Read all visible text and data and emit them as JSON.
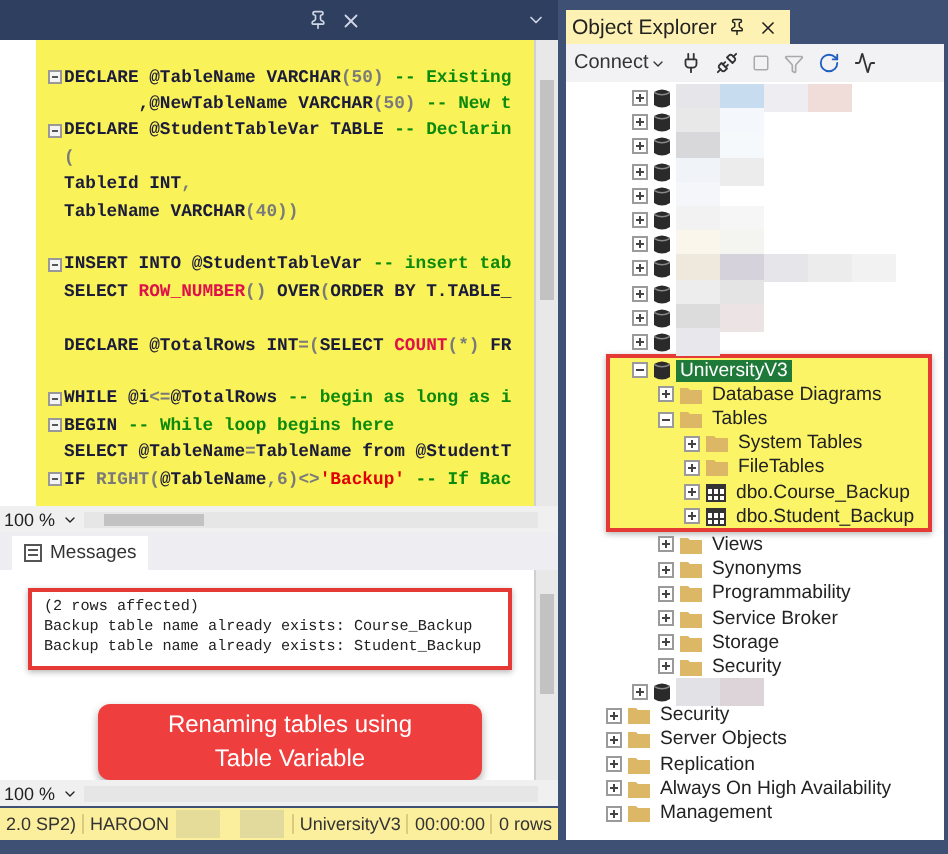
{
  "editor": {
    "lines": [
      {
        "fold": true,
        "tokens": [
          {
            "kind": "kw",
            "text": "DECLARE @TableName VARCHAR"
          },
          {
            "kind": "punct",
            "text": "(50)"
          },
          {
            "kind": "comment",
            "text": " -- Existing"
          }
        ]
      },
      {
        "fold": false,
        "tokens": [
          {
            "kind": "kw",
            "text": "       ,@NewTableName VARCHAR"
          },
          {
            "kind": "punct",
            "text": "(50)"
          },
          {
            "kind": "comment",
            "text": " -- New t"
          }
        ]
      },
      {
        "fold": true,
        "tokens": [
          {
            "kind": "kw",
            "text": "DECLARE @StudentTableVar TABLE"
          },
          {
            "kind": "comment",
            "text": " -- Declarin"
          }
        ]
      },
      {
        "fold": false,
        "tokens": [
          {
            "kind": "punct",
            "text": "("
          }
        ]
      },
      {
        "fold": false,
        "tokens": [
          {
            "kind": "kw",
            "text": "TableId INT"
          },
          {
            "kind": "punct",
            "text": ","
          }
        ]
      },
      {
        "fold": false,
        "tokens": [
          {
            "kind": "kw",
            "text": "TableName VARCHAR"
          },
          {
            "kind": "punct",
            "text": "(40))"
          }
        ]
      },
      {
        "fold": false
      },
      {
        "fold": true,
        "tokens": [
          {
            "kind": "kw",
            "text": "INSERT INTO @StudentTableVar"
          },
          {
            "kind": "comment",
            "text": " -- insert tab"
          }
        ]
      },
      {
        "fold": false,
        "tokens": [
          {
            "kind": "kw",
            "text": "SELECT "
          },
          {
            "kind": "func",
            "text": "ROW_NUMBER"
          },
          {
            "kind": "punct",
            "text": "() "
          },
          {
            "kind": "kw",
            "text": "OVER"
          },
          {
            "kind": "punct",
            "text": "("
          },
          {
            "kind": "kw",
            "text": "ORDER BY T.TABLE_"
          }
        ]
      },
      {
        "fold": false
      },
      {
        "fold": false,
        "tokens": [
          {
            "kind": "kw",
            "text": "DECLARE @TotalRows INT"
          },
          {
            "kind": "punct",
            "text": "=("
          },
          {
            "kind": "kw",
            "text": "SELECT "
          },
          {
            "kind": "func",
            "text": "COUNT"
          },
          {
            "kind": "punct",
            "text": "(*) "
          },
          {
            "kind": "kw",
            "text": "FR"
          }
        ]
      },
      {
        "fold": false
      },
      {
        "fold": true,
        "tokens": [
          {
            "kind": "kw",
            "text": "WHILE @i"
          },
          {
            "kind": "punct",
            "text": "<="
          },
          {
            "kind": "kw",
            "text": "@TotalRows"
          },
          {
            "kind": "comment",
            "text": " -- begin as long as i"
          }
        ]
      },
      {
        "fold": true,
        "tokens": [
          {
            "kind": "kw",
            "text": "BEGIN"
          },
          {
            "kind": "comment",
            "text": " -- While loop begins here"
          }
        ]
      },
      {
        "fold": false,
        "tokens": [
          {
            "kind": "kw",
            "text": "SELECT @TableName"
          },
          {
            "kind": "punct",
            "text": "="
          },
          {
            "kind": "kw",
            "text": "TableName from @StudentT"
          }
        ]
      },
      {
        "fold": true,
        "tokens": [
          {
            "kind": "kw",
            "text": "IF "
          },
          {
            "kind": "punct",
            "text": "RIGHT("
          },
          {
            "kind": "kw",
            "text": "@TableName"
          },
          {
            "kind": "punct",
            "text": ",6)<>"
          },
          {
            "kind": "str",
            "text": "'Backup'"
          },
          {
            "kind": "comment",
            "text": " -- If Bac"
          }
        ]
      }
    ],
    "zoom": "100 %"
  },
  "messages_tab": {
    "label": "Messages"
  },
  "messages": {
    "lines": [
      "(2 rows affected)",
      "Backup table name already exists: Course_Backup",
      "Backup table name already exists: Student_Backup"
    ],
    "zoom": "100 %"
  },
  "callout": "Renaming tables using Table Variable",
  "status_bar": {
    "items": [
      "2.0 SP2)",
      "HAROON",
      "UniversityV3",
      "00:00:00",
      "0 rows"
    ]
  },
  "object_explorer": {
    "title": "Object Explorer",
    "connect": "Connect",
    "databases": [
      {
        "kind": "redacted",
        "expanded": false,
        "selected": false,
        "highlighted": false
      },
      {
        "kind": "redacted",
        "expanded": false,
        "selected": false,
        "highlighted": false
      },
      {
        "kind": "redacted",
        "expanded": false,
        "selected": false,
        "highlighted": false
      },
      {
        "kind": "redacted",
        "expanded": false,
        "selected": false,
        "highlighted": false
      },
      {
        "kind": "redacted",
        "expanded": false,
        "selected": false,
        "highlighted": false
      },
      {
        "kind": "redacted",
        "expanded": false,
        "selected": false,
        "highlighted": false
      },
      {
        "kind": "redacted",
        "expanded": false,
        "selected": false,
        "highlighted": false
      },
      {
        "kind": "redacted",
        "expanded": false,
        "selected": false,
        "highlighted": false
      },
      {
        "kind": "redacted",
        "expanded": false,
        "selected": false,
        "highlighted": false
      },
      {
        "kind": "redacted",
        "expanded": false,
        "selected": false,
        "highlighted": false
      },
      {
        "kind": "redacted",
        "expanded": false,
        "selected": false,
        "highlighted": false
      },
      {
        "kind": "database",
        "label": "UniversityV3",
        "expanded": true,
        "selected": true,
        "highlighted": true,
        "children": [
          {
            "kind": "folder",
            "label": "Database Diagrams",
            "expanded": false,
            "selected": false,
            "highlighted": true
          },
          {
            "kind": "folder",
            "label": "Tables",
            "expanded": true,
            "selected": false,
            "highlighted": true,
            "children": [
              {
                "kind": "folder",
                "label": "System Tables",
                "expanded": false,
                "selected": false,
                "highlighted": true
              },
              {
                "kind": "folder",
                "label": "FileTables",
                "expanded": false,
                "selected": false,
                "highlighted": true
              },
              {
                "kind": "table",
                "label": "dbo.Course_Backup",
                "expanded": false,
                "selected": false,
                "highlighted": true
              },
              {
                "kind": "table",
                "label": "dbo.Student_Backup",
                "expanded": false,
                "selected": false,
                "highlighted": true
              }
            ]
          },
          {
            "kind": "folder",
            "label": "Views",
            "expanded": false,
            "selected": false,
            "highlighted": false
          },
          {
            "kind": "folder",
            "label": "Synonyms",
            "expanded": false,
            "selected": false,
            "highlighted": false
          },
          {
            "kind": "folder",
            "label": "Programmability",
            "expanded": false,
            "selected": false,
            "highlighted": false
          },
          {
            "kind": "folder",
            "label": "Service Broker",
            "expanded": false,
            "selected": false,
            "highlighted": false
          },
          {
            "kind": "folder",
            "label": "Storage",
            "expanded": false,
            "selected": false,
            "highlighted": false
          },
          {
            "kind": "folder",
            "label": "Security",
            "expanded": false,
            "selected": false,
            "highlighted": false
          }
        ]
      },
      {
        "kind": "redacted",
        "expanded": false,
        "selected": false,
        "highlighted": false
      }
    ],
    "server_folders": [
      {
        "kind": "folder",
        "label": "Security",
        "expanded": false,
        "selected": false,
        "highlighted": false
      },
      {
        "kind": "folder",
        "label": "Server Objects",
        "expanded": false,
        "selected": false,
        "highlighted": false
      },
      {
        "kind": "folder",
        "label": "Replication",
        "expanded": false,
        "selected": false,
        "highlighted": false
      },
      {
        "kind": "folder",
        "label": "Always On High Availability",
        "expanded": false,
        "selected": false,
        "highlighted": false
      },
      {
        "kind": "folder",
        "label": "Management",
        "expanded": false,
        "selected": false,
        "highlighted": false
      }
    ]
  }
}
